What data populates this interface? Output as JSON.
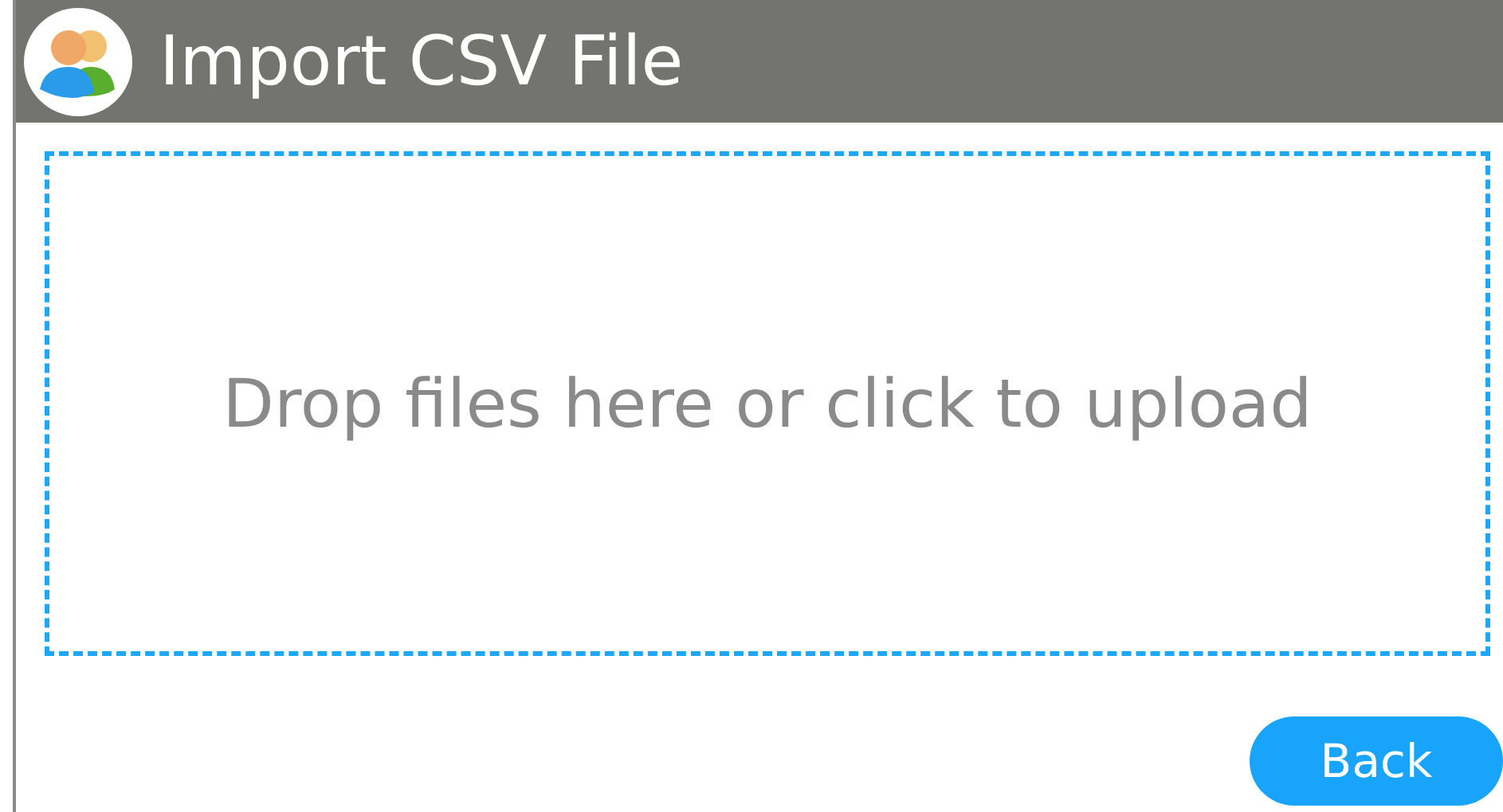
{
  "window": {
    "title": "Import CSV File"
  },
  "dropzone": {
    "text": "Drop files here or click to upload"
  },
  "buttons": [
    {
      "label": "Back"
    }
  ]
}
